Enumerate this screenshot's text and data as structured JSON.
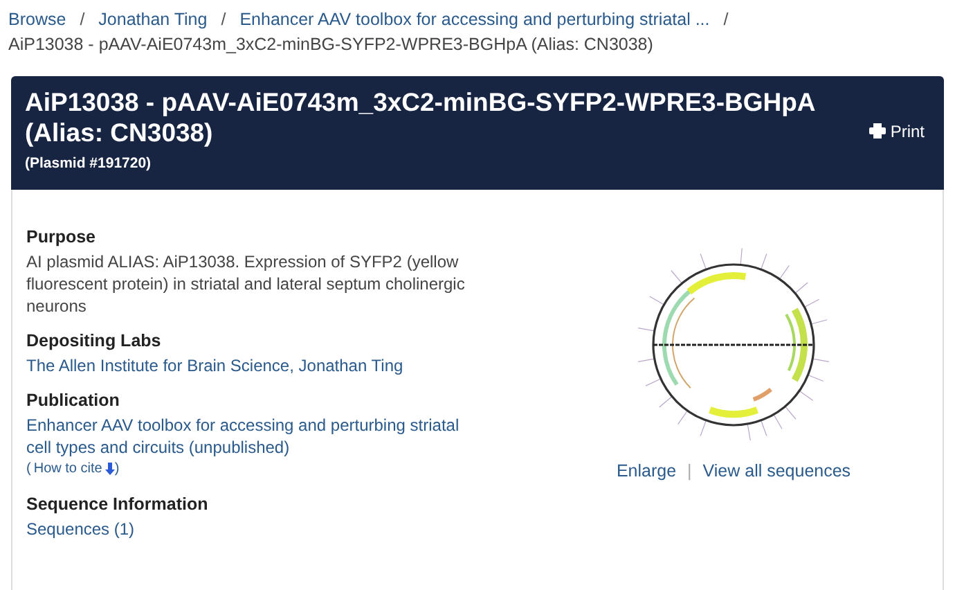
{
  "breadcrumb": {
    "links": [
      {
        "label": "Browse"
      },
      {
        "label": "Jonathan Ting"
      },
      {
        "label": "Enhancer AAV toolbox for accessing and perturbing striatal ..."
      }
    ],
    "separator": "/",
    "current": "AiP13038 - pAAV-AiE0743m_3xC2-minBG-SYFP2-WPRE3-BGHpA (Alias: CN3038)"
  },
  "header": {
    "title": "AiP13038 - pAAV-AiE0743m_3xC2-minBG-SYFP2-WPRE3-BGHpA (Alias: CN3038)",
    "subtitle": "(Plasmid #191720)",
    "print_label": "Print"
  },
  "sections": [
    {
      "heading": "Purpose",
      "kind": "text",
      "text": "AI plasmid ALIAS: AiP13038. Expression of SYFP2 (yellow fluorescent protein) in striatal and lateral septum cholinergic neurons"
    },
    {
      "heading": "Depositing Labs",
      "kind": "link",
      "text": "The Allen Institute for Brain Science, Jonathan Ting"
    },
    {
      "heading": "Publication",
      "kind": "publication",
      "text": "Enhancer AAV toolbox for accessing and perturbing striatal cell types and circuits (unpublished)",
      "cite_open": "(",
      "cite_label": "How to cite",
      "cite_close": ")"
    },
    {
      "heading": "Sequence Information",
      "kind": "link",
      "text": "Sequences (1)"
    }
  ],
  "map_links": {
    "enlarge": "Enlarge",
    "separator": "|",
    "view_all": "View all sequences"
  }
}
